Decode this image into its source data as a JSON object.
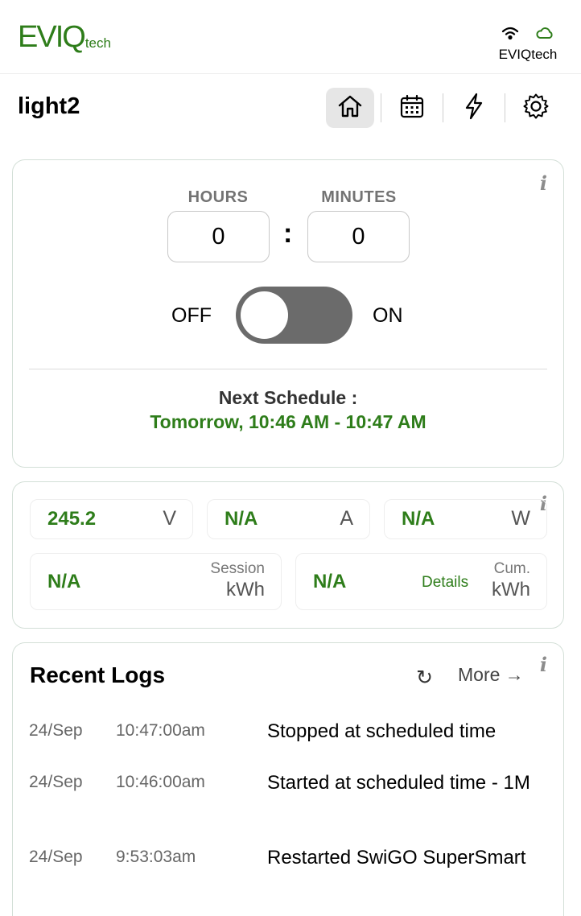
{
  "brand": {
    "logo_main": "EVIQ",
    "logo_sub": "tech",
    "color": "#2e7d1a"
  },
  "connection": {
    "label": "EVIQtech",
    "icons": [
      "wifi-icon",
      "cloud-icon"
    ]
  },
  "device": {
    "title": "light2"
  },
  "nav": {
    "active": "home",
    "items": [
      {
        "name": "home",
        "icon": "home-icon"
      },
      {
        "name": "schedule",
        "icon": "calendar-icon"
      },
      {
        "name": "power",
        "icon": "lightning-icon"
      },
      {
        "name": "settings",
        "icon": "gear-icon"
      }
    ]
  },
  "timer": {
    "hours_label": "HOURS",
    "minutes_label": "MINUTES",
    "hours_value": "0",
    "minutes_value": "0",
    "separator": ":",
    "off_label": "OFF",
    "on_label": "ON",
    "toggle_state": "off",
    "next_schedule_label": "Next Schedule :",
    "next_schedule_value": "Tomorrow, 10:46 AM - 10:47 AM",
    "info": "i"
  },
  "meter": {
    "info": "i",
    "voltage": {
      "value": "245.2",
      "unit": "V"
    },
    "current": {
      "value": "N/A",
      "unit": "A"
    },
    "power": {
      "value": "N/A",
      "unit": "W"
    },
    "session": {
      "value": "N/A",
      "label": "Session",
      "unit": "kWh"
    },
    "cumulative": {
      "value": "N/A",
      "details": "Details",
      "label": "Cum.",
      "unit": "kWh"
    }
  },
  "logs": {
    "title": "Recent Logs",
    "refresh_icon": "↻",
    "more": "More →",
    "info": "i",
    "entries": [
      {
        "date": "24/Sep",
        "time": "10:47:00am",
        "message": "Stopped at scheduled time"
      },
      {
        "date": "24/Sep",
        "time": "10:46:00am",
        "message": "Started at scheduled time - 1M"
      },
      {
        "date": "24/Sep",
        "time": "9:53:03am",
        "message": "Restarted SwiGO SuperSmart"
      }
    ]
  }
}
